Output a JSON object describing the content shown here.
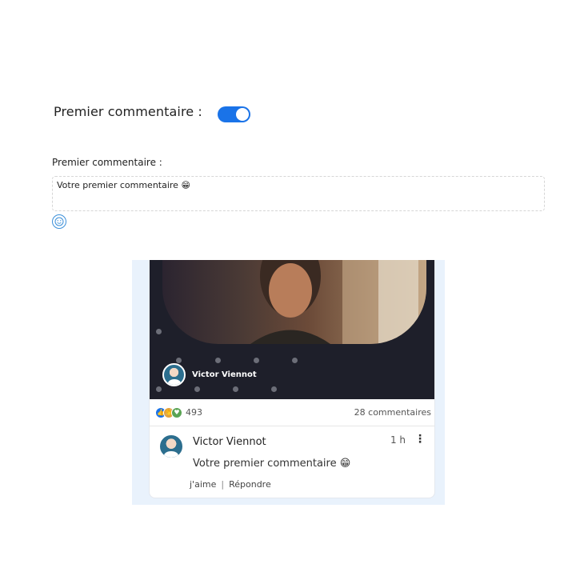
{
  "settings": {
    "toggle_label": "Premier commentaire :",
    "toggle_on": true,
    "field_label": "Premier commentaire :",
    "comment_value": "Votre premier commentaire 😁"
  },
  "preview": {
    "author_name": "Victor Viennot",
    "reactions_count": "493",
    "comments_count": "28 commentaires",
    "comment": {
      "author": "Victor Viennot",
      "time": "1 h",
      "text": "Votre premier commentaire 😁",
      "like_label": "j'aime",
      "separator": "|",
      "reply_label": "Répondre"
    }
  },
  "icons": {
    "emoji_button": "smiley-icon",
    "more": "vertical-dots-icon",
    "reactions": [
      "like-icon",
      "celebrate-icon",
      "support-icon"
    ]
  },
  "colors": {
    "accent": "#1a73e8",
    "hero_bg": "#1e1f2a",
    "preview_bg": "#e9f2fc"
  }
}
